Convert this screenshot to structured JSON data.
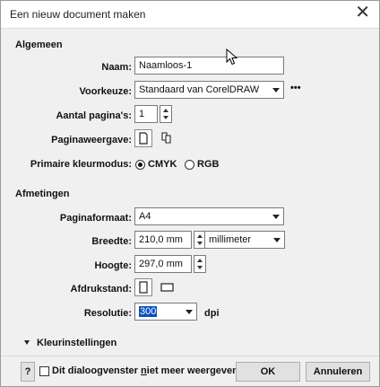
{
  "window": {
    "title": "Een nieuw document maken",
    "close_glyph": "✕"
  },
  "general": {
    "heading": "Algemeen",
    "name_label": "Naam:",
    "name_value": "Naamloos-1",
    "preset_label": "Voorkeuze:",
    "preset_value": "Standaard van CorelDRAW",
    "preset_more": "•••",
    "pages_label": "Aantal pagina's:",
    "pages_value": "1",
    "pageview_label": "Paginaweergave:",
    "colormode_label": "Primaire kleurmodus:",
    "colormode_options": [
      "CMYK",
      "RGB"
    ],
    "colormode_selected": "CMYK"
  },
  "dimensions": {
    "heading": "Afmetingen",
    "pagesize_label": "Paginaformaat:",
    "pagesize_value": "A4",
    "width_label": "Breedte:",
    "width_value": "210,0 mm",
    "unit_value": "millimeter",
    "height_label": "Hoogte:",
    "height_value": "297,0 mm",
    "orientation_label": "Afdrukstand:",
    "resolution_label": "Resolutie:",
    "resolution_value": "300",
    "resolution_unit": "dpi"
  },
  "color_settings": {
    "label": "Kleurinstellingen"
  },
  "footer": {
    "help_label": "?",
    "dont_show_pre": "Dit dialoogvenster ",
    "dont_show_underlined": "n",
    "dont_show_post": "iet meer weergeven",
    "ok_label": "OK",
    "cancel_label": "Annuleren"
  },
  "colors": {
    "selection": "#0a4ec2",
    "dialog_bg": "#f0f0f0"
  }
}
